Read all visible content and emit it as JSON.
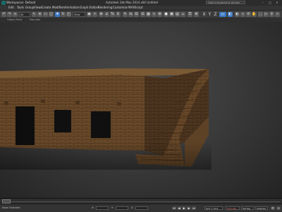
{
  "title_bar": {
    "workspace": "Workspaces: Default",
    "title": "Autodesk 3ds Max 2014 x64    Untitled",
    "search_placeholder": "Type a keyword or phrase",
    "minimize": "–",
    "maximize": "□",
    "close": "×"
  },
  "menu": {
    "items": [
      "Edit",
      "Tools",
      "Group",
      "Views",
      "Create",
      "Modifiers",
      "Animation",
      "Graph Editors",
      "Rendering",
      "Customize",
      "MAXScript"
    ]
  },
  "toolbar": {
    "selection_set": "All",
    "reference_coord": "View",
    "axes": [
      "X",
      "Y",
      "Z",
      "XY"
    ]
  },
  "ribbon": {
    "items": [
      "Object Paint",
      "Populate"
    ]
  },
  "timeline": {
    "frame_label": "0 / 100"
  },
  "status_bar": {
    "selected": "None Selected",
    "x_label": "X:",
    "y_label": "Y:",
    "z_label": "Z:",
    "grid": "Grid = 10.0",
    "auto_key": "Auto Key",
    "set_key": "Set Key",
    "key_mode": "Selected"
  },
  "colors": {
    "viewport_bg": "#3b3b3b",
    "brick": "#6a4a2a",
    "accent_blue": "#3a78c4"
  }
}
